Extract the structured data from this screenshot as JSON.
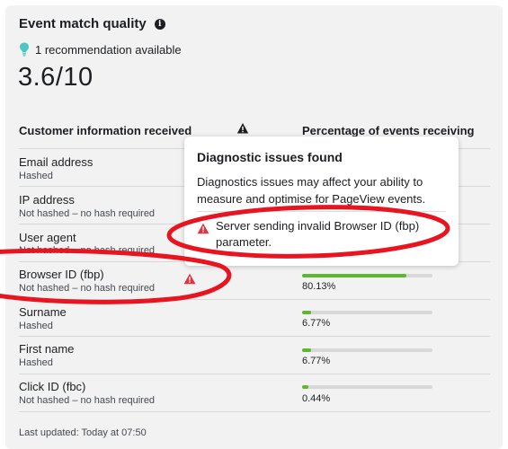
{
  "panel": {
    "title": "Event match quality",
    "info_icon": "info-icon",
    "recommendation": "1 recommendation available",
    "recommendation_icon": "lightbulb-icon",
    "score": "3.6/10"
  },
  "table": {
    "col_customer": "Customer information received",
    "col_percentage": "Percentage of events receiving",
    "rows": [
      {
        "name": "Email address",
        "sub": "Hashed",
        "pct": null,
        "fraction": null
      },
      {
        "name": "IP address",
        "sub": "Not hashed – no hash required",
        "pct": null,
        "fraction": null
      },
      {
        "name": "User agent",
        "sub": "Not hashed – no hash required",
        "pct": null,
        "fraction": null
      },
      {
        "name": "Browser ID (fbp)",
        "sub": "Not hashed – no hash required",
        "pct": "80.13%",
        "fraction": 0.8013,
        "warning": true
      },
      {
        "name": "Surname",
        "sub": "Hashed",
        "pct": "6.77%",
        "fraction": 0.0677
      },
      {
        "name": "First name",
        "sub": "Hashed",
        "pct": "6.77%",
        "fraction": 0.0677
      },
      {
        "name": "Click ID (fbc)",
        "sub": "Not hashed – no hash required",
        "pct": "0.44%",
        "fraction": 0.0044
      }
    ]
  },
  "last_updated": "Last updated: Today at 07:50",
  "popover": {
    "title": "Diagnostic issues found",
    "body": "Diagnostics issues may affect your ability to measure and optimise for PageView events.",
    "issue": "Server sending invalid Browser ID (fbp) parameter.",
    "issue_icon": "warning-icon"
  },
  "colors": {
    "accent_green": "#5cb82e",
    "warning_red": "#e0323f",
    "annotation_red": "#e8141f",
    "card_bg": "#f2f2f2"
  }
}
